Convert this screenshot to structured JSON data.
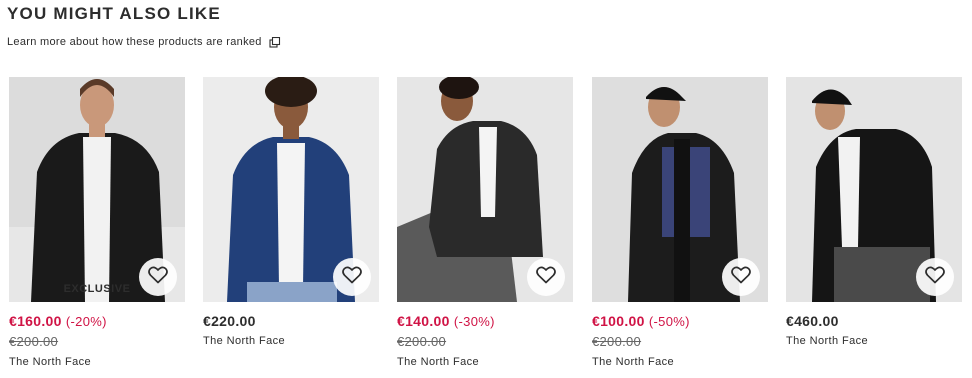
{
  "section": {
    "title": "YOU MIGHT ALSO LIKE",
    "ranked_link": "Learn more about how these products are ranked",
    "ranked_icon": "external-link-icon"
  },
  "products": [
    {
      "badge": "EXCLUSIVE",
      "price": "€160.00",
      "discount": "(-20%)",
      "was": "€200.00",
      "brand": "The North Face",
      "jacket_color": "#1a1a1a",
      "jacket_panel": "#1a1a1a",
      "sale": true
    },
    {
      "badge": "",
      "price": "€220.00",
      "discount": "",
      "was": "",
      "brand": "The North Face",
      "jacket_color": "#22407a",
      "jacket_panel": "#22407a",
      "sale": false
    },
    {
      "badge": "",
      "price": "€140.00",
      "discount": "(-30%)",
      "was": "€200.00",
      "brand": "The North Face",
      "jacket_color": "#2a2a2a",
      "jacket_panel": "#2a2a2a",
      "sale": true
    },
    {
      "badge": "",
      "price": "€100.00",
      "discount": "(-50%)",
      "was": "€200.00",
      "brand": "The North Face",
      "jacket_color": "#1c1c1c",
      "jacket_panel": "#3a4478",
      "sale": true
    },
    {
      "badge": "",
      "price": "€460.00",
      "discount": "",
      "was": "",
      "brand": "The North Face",
      "jacket_color": "#151515",
      "jacket_panel": "#151515",
      "sale": false
    }
  ],
  "colors": {
    "sale": "#d01345",
    "text": "#2d2d2d"
  },
  "icons": {
    "favourite": "heart-icon"
  }
}
